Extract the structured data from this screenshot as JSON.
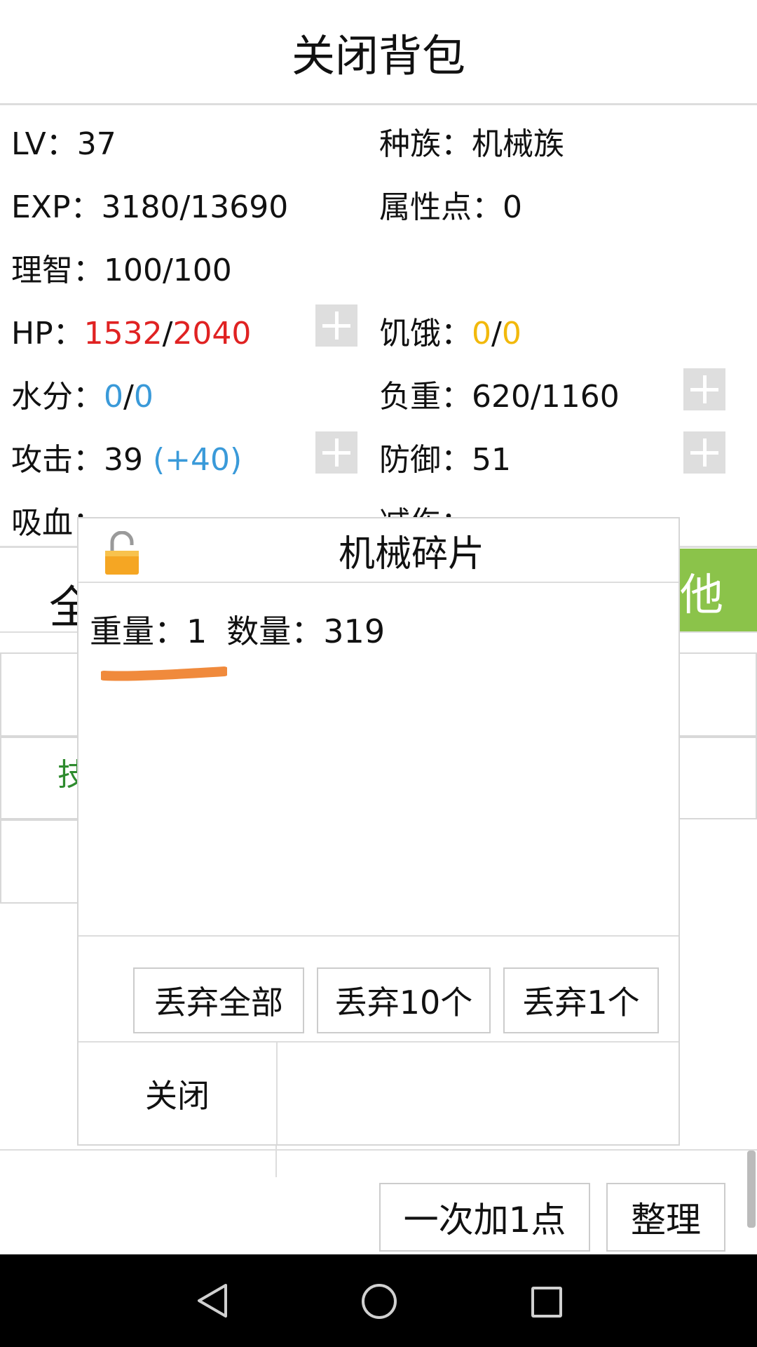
{
  "header": {
    "title": "关闭背包"
  },
  "stats": {
    "lv_label": "LV：",
    "lv_value": "37",
    "race_label": "种族：",
    "race_value": "机械族",
    "exp_label": "EXP：",
    "exp_value": "3180/13690",
    "attr_label": "属性点：",
    "attr_value": "0",
    "sanity_label": "理智：",
    "sanity_value": "100/100",
    "hp_label": "HP：",
    "hp_current": "1532",
    "hp_sep": "/",
    "hp_max": "2040",
    "hunger_label": "饥饿：",
    "hunger_current": "0",
    "hunger_sep": "/",
    "hunger_max": "0",
    "water_label": "水分：",
    "water_current": "0",
    "water_sep": "/",
    "water_max": "0",
    "load_label": "负重：",
    "load_value": "620/1160",
    "attack_label": "攻击：",
    "attack_value": "39 ",
    "attack_bonus": "(+40)",
    "defense_label": "防御：",
    "defense_value": "51",
    "lifesteal_partial": "吸血：",
    "reduction_partial": "减伤："
  },
  "background": {
    "tab_partial": "全",
    "green_tab_partial": "他",
    "green_item_partial": "技"
  },
  "bottom": {
    "add_one_label": "一次加1点",
    "sort_label": "整理"
  },
  "dialog": {
    "title": "机械碎片",
    "weight_label": "重量：",
    "weight_value": "1",
    "count_label": "数量：",
    "count_value": "319",
    "discard_all": "丢弃全部",
    "discard_ten": "丢弃10个",
    "discard_one": "丢弃1个",
    "close": "关闭"
  },
  "colors": {
    "hp": "#e02222",
    "hunger": "#f2b90c",
    "water": "#3a9ad9",
    "accent_green": "#8bc34a",
    "scribble": "#f08a3c"
  },
  "icons": [
    "plus-icon",
    "lock-icon",
    "back-icon",
    "home-icon",
    "recents-icon"
  ]
}
